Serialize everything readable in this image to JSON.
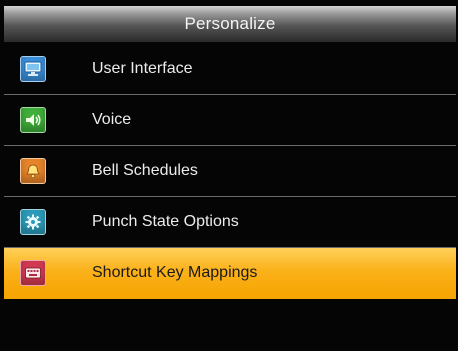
{
  "title": "Personalize",
  "menu": {
    "items": [
      {
        "label": "User Interface",
        "icon": "monitor-icon",
        "color": "#3a8ed9"
      },
      {
        "label": "Voice",
        "icon": "speaker-icon",
        "color": "#3fae3a"
      },
      {
        "label": "Bell Schedules",
        "icon": "bell-icon",
        "color": "#e7852a"
      },
      {
        "label": "Punch State Options",
        "icon": "gear-icon",
        "color": "#2c9ab8"
      },
      {
        "label": "Shortcut Key Mappings",
        "icon": "keyboard-icon",
        "color": "#d23a52",
        "selected": true
      }
    ]
  },
  "colors": {
    "background": "#050505",
    "highlight": "#fbb21a"
  }
}
